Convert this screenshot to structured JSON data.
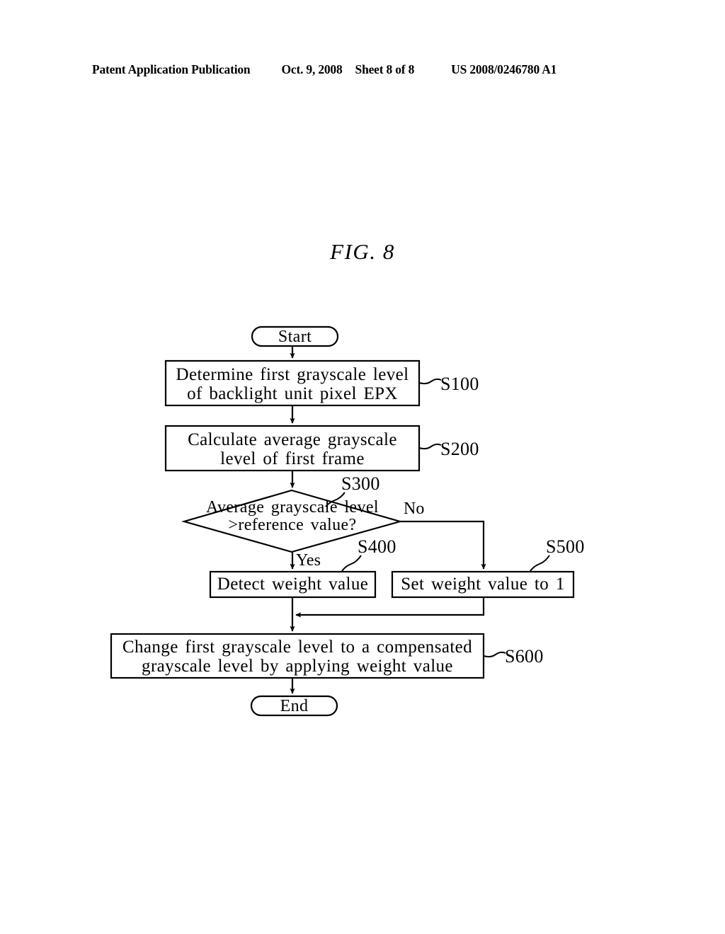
{
  "header": {
    "publication": "Patent Application Publication",
    "date": "Oct. 9, 2008",
    "sheet": "Sheet 8 of 8",
    "number": "US 2008/0246780 A1"
  },
  "figure": {
    "title": "FIG. 8"
  },
  "flowchart": {
    "start_label": "Start",
    "end_label": "End",
    "yes_label": "Yes",
    "no_label": "No",
    "steps": [
      {
        "id": "S100",
        "shape": "process",
        "text": "Determine first grayscale level\nof backlight unit pixel EPX",
        "ref": "S100"
      },
      {
        "id": "S200",
        "shape": "process",
        "text": "Calculate average grayscale\nlevel of first frame",
        "ref": "S200"
      },
      {
        "id": "S300",
        "shape": "decision",
        "text": "Average grayscale level\n>reference value?",
        "ref": "S300"
      },
      {
        "id": "S400",
        "shape": "process",
        "text": "Detect weight value",
        "ref": "S400"
      },
      {
        "id": "S500",
        "shape": "process",
        "text": "Set weight value to 1",
        "ref": "S500"
      },
      {
        "id": "S600",
        "shape": "process",
        "text": "Change first grayscale level to a compensated\ngrayscale level by applying weight value",
        "ref": "S600"
      }
    ]
  },
  "colors": {
    "ink": "#000000",
    "paper": "#ffffff"
  }
}
